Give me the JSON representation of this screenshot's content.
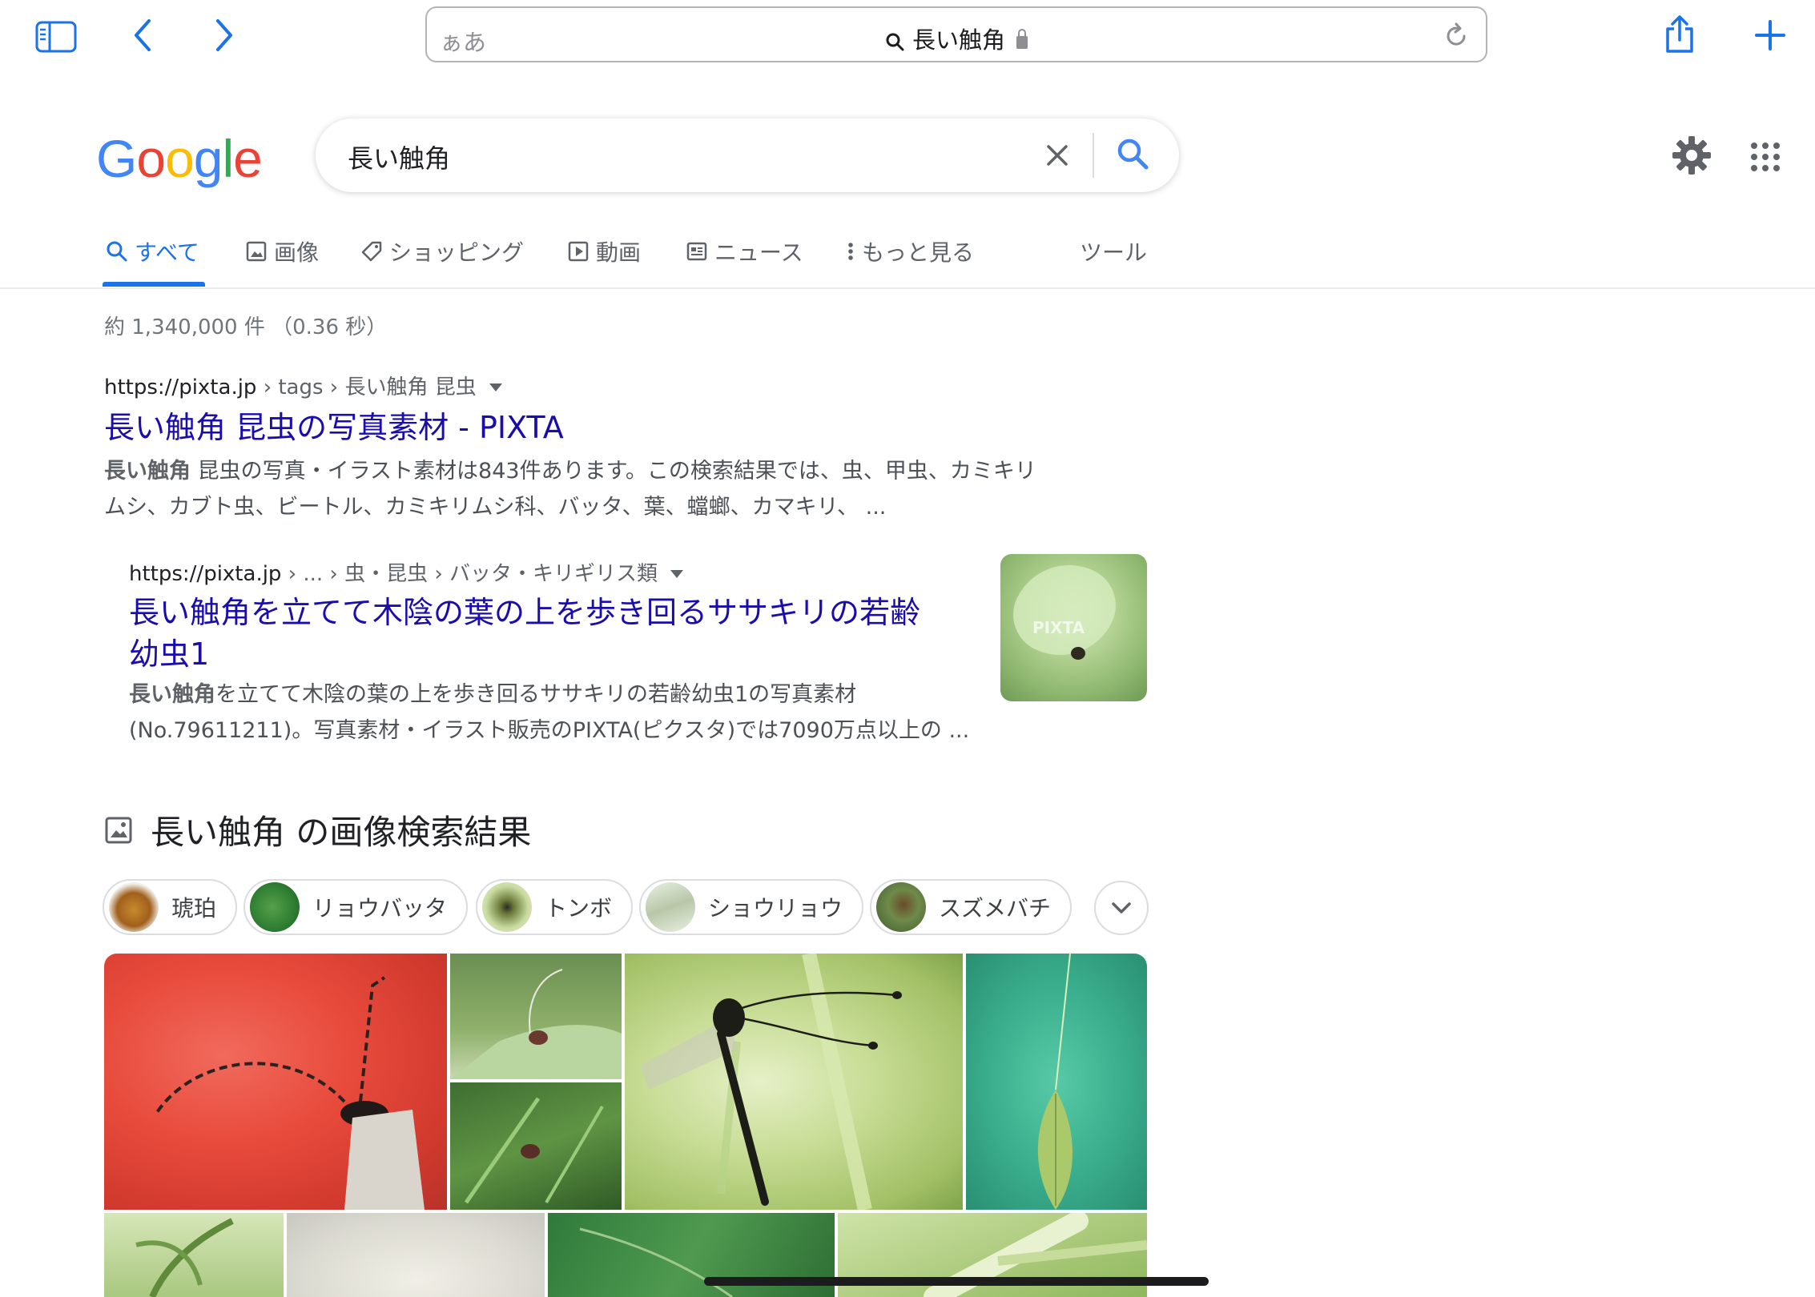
{
  "browser": {
    "address_aa": "ぁあ",
    "address_text": "長い触角",
    "colors": {
      "accent": "#1a73e8"
    }
  },
  "google": {
    "logo": [
      "G",
      "o",
      "o",
      "g",
      "l",
      "e"
    ],
    "logo_colors": [
      "#4285f4",
      "#ea4335",
      "#fbbc05",
      "#4285f4",
      "#34a853",
      "#ea4335"
    ],
    "query": "長い触角",
    "tabs": [
      {
        "label": "すべて",
        "icon": "search-icon",
        "active": true
      },
      {
        "label": "画像",
        "icon": "image-icon"
      },
      {
        "label": "ショッピング",
        "icon": "tag-icon"
      },
      {
        "label": "動画",
        "icon": "video-icon"
      },
      {
        "label": "ニュース",
        "icon": "news-icon"
      },
      {
        "label": "もっと見る",
        "icon": "more-vert-icon"
      },
      {
        "label": "ツール"
      }
    ],
    "stats": "約 1,340,000 件 （0.36 秒）"
  },
  "results": [
    {
      "url_host": "https://pixta.jp",
      "url_path": " › tags › 長い触角 昆虫",
      "title": "長い触角 昆虫の写真素材 - PIXTA",
      "snippet_bold": "長い触角",
      "snippet_line1": " 昆虫の写真・イラスト素材は843件あります。この検索結果では、虫、甲虫、カミキリ",
      "snippet_line2": "ムシ、カブト虫、ビートル、カミキリムシ科、バッタ、葉、蟷螂、カマキリ、 ..."
    },
    {
      "url_host": "https://pixta.jp",
      "url_path": " › ... › 虫・昆虫 › バッタ・キリギリス類",
      "title_line1": "長い触角を立てて木陰の葉の上を歩き回るササキリの若齢",
      "title_line2": "幼虫1",
      "snippet_bold": "長い触角",
      "snippet_line1": "を立てて木陰の葉の上を歩き回るササキリの若齢幼虫1の写真素材",
      "snippet_line2": "(No.79611211)。写真素材・イラスト販売のPIXTA(ピクスタ)では7090万点以上の ...",
      "thumb_watermark": "PIXTA"
    }
  ],
  "images": {
    "heading": "長い触角 の画像検索結果",
    "chips": [
      "琥珀",
      "リョウバッタ",
      "トンボ",
      "ショウリョウ",
      "スズメバチ"
    ]
  }
}
